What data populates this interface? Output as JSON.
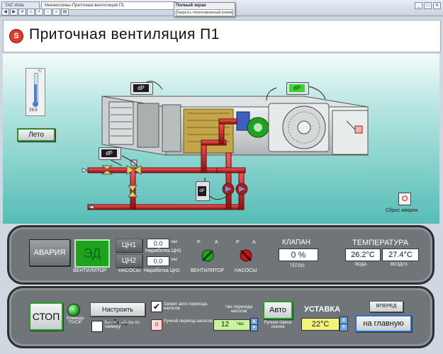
{
  "topbar": {
    "tab1": "TAC Vista",
    "tab2": "Мнемосхемы-Приточная вентиляция П1",
    "fs_title": "Полный экран",
    "fs_button": "Закрыть полноэкранный режим"
  },
  "title": {
    "icon_letter": "S",
    "text": "Приточная  вентиляция П1"
  },
  "thermometer": {
    "value": "29.5",
    "unit": "°C"
  },
  "season_button": "Лето",
  "dp_label": "dP",
  "reset_alarm": {
    "icon": "O",
    "label": "Сброс аварии"
  },
  "panel1": {
    "alarm_button": "АВАРИЯ",
    "ed_button": "ЭД",
    "fan_label": "ВЕНТИЛЯТОР",
    "pumps_label": "НАСОСЫ",
    "cn1": "ЦН1",
    "cn2": "ЦН2",
    "runtime1_value": "0.0",
    "runtime1_unit": "час",
    "runtime1_label": "Наработка ЦН1",
    "runtime2_value": "0.0",
    "runtime2_unit": "час",
    "runtime2_label": "Наработка ЦН2",
    "switch_r": "Р",
    "switch_a": "А",
    "switch_fan_label": "ВЕНТИЛЯТОР",
    "switch_pumps_label": "НАСОСЫ",
    "valve_title": "КЛАПАН",
    "valve_value": "0 %",
    "valve_label": "ТЕПЛО",
    "temp_title": "ТЕМПЕРАТУРА",
    "temp_water": "26.2°C",
    "temp_air": "27.4°C",
    "water_label": "ВОДА",
    "air_label": "ВОЗДУХ"
  },
  "panel2": {
    "stop_button": "СТОП",
    "start_cmd_label": "Команда \"ПУСК\"",
    "timer_button": "Настроить таймер",
    "timer_block_label": "Запрет работы по таймеру",
    "auto_block_label": "Запрет авто перехода насосов",
    "manual_switch_label": "Ручной переход насосов",
    "manual_switch_icon": "II",
    "hour_title": "Час перехода насосов",
    "hour_value": "12",
    "hour_unit": "Час",
    "auto_button": "Авто",
    "season_manual_label": "Ручная смена сезона",
    "setpoint_title": "УСТАВКА",
    "setpoint_value": "22°C",
    "forward_button": "ВПЕРЕД",
    "home_button": "на главную"
  },
  "colors": {
    "alarm_red": "#e23b2e",
    "accent_green": "#1fa31f",
    "teal": "#55bdb6",
    "pipe_red": "#c0161a"
  }
}
